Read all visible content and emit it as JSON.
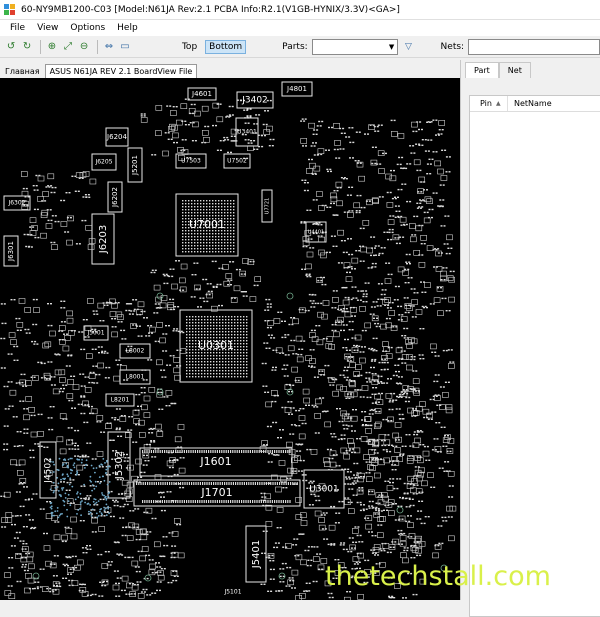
{
  "window": {
    "title": "60-NY9MB1200-C03 [Model:N61JA Rev:2.1 PCBA Info:R2.1(V1GB-HYNIX/3.3V)<GA>]"
  },
  "menu": [
    "File",
    "View",
    "Options",
    "Help"
  ],
  "toolbar": {
    "top_label": "Top",
    "bottom_label": "Bottom",
    "parts_label": "Parts:",
    "nets_label": "Nets:"
  },
  "tabs": {
    "home": "Главная",
    "document": "ASUS N61JA REV 2.1 BoardView File"
  },
  "panel": {
    "tabs": [
      "Part",
      "Net"
    ],
    "columns": [
      "Pin",
      "NetName"
    ]
  },
  "board": {
    "labels": [
      "J4601",
      "J3402",
      "J4801",
      "U3401",
      "J6204",
      "J6205",
      "J5201",
      "U7503",
      "U7502",
      "J6202",
      "J6302",
      "U7001",
      "J6203",
      "J6301",
      "J5001",
      "L8002",
      "L8001",
      "L8201",
      "J5302",
      "J4502",
      "U0301",
      "J1601",
      "J1701",
      "U3001",
      "J5401",
      "J5101",
      "U7721",
      "U4401"
    ]
  },
  "watermark": "thetechstall.com"
}
